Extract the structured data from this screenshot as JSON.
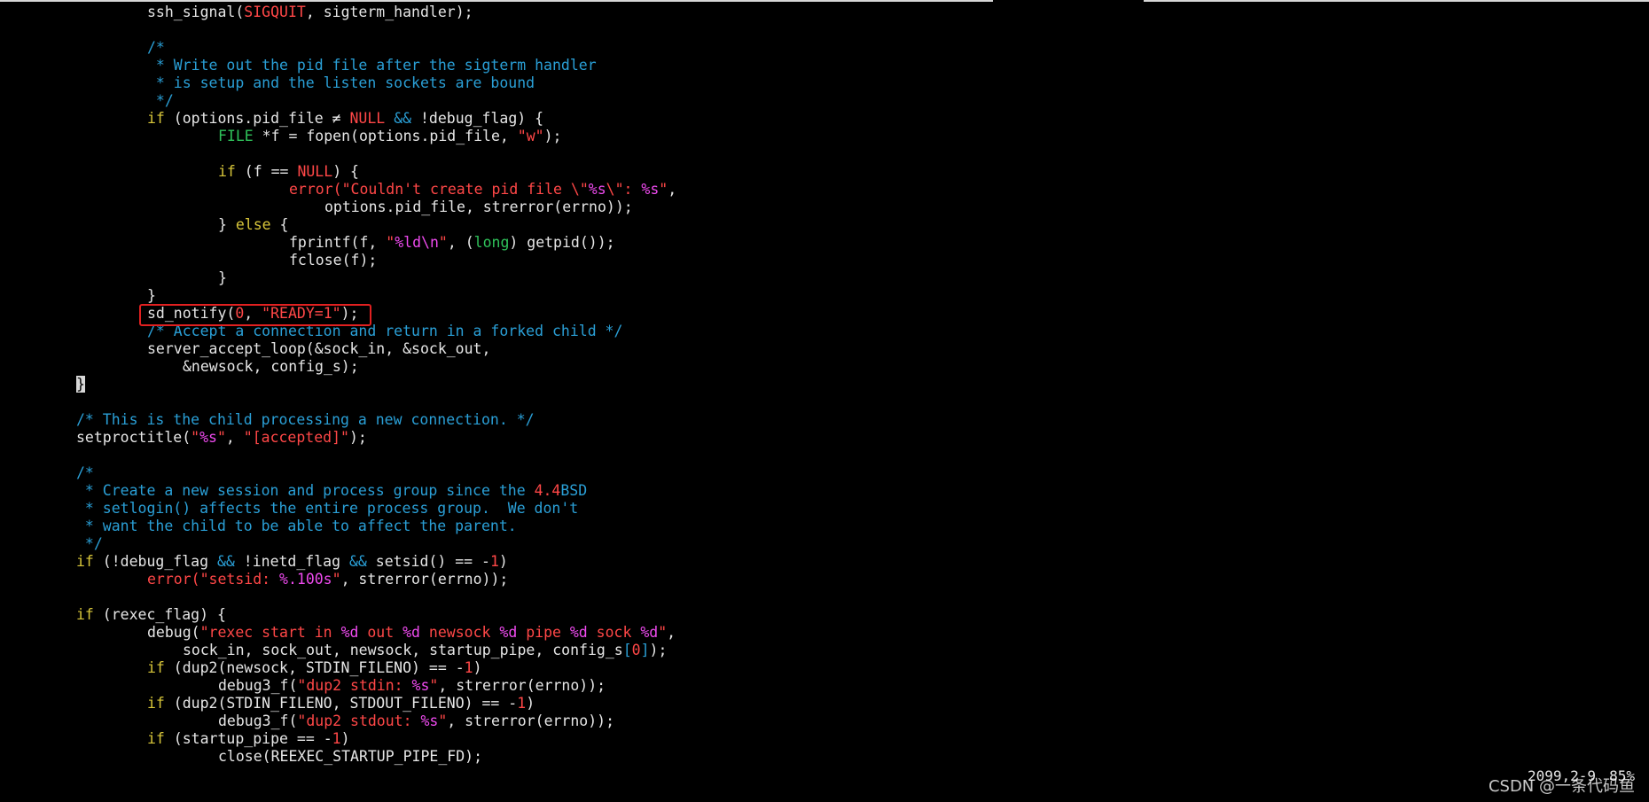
{
  "editor": {
    "lines": [
      {
        "indent": 2,
        "tokens": [
          [
            "fn-plain",
            "ssh_signal("
          ],
          [
            "const",
            "SIGQUIT"
          ],
          [
            "plain",
            ", sigterm_handler);"
          ]
        ]
      },
      {
        "indent": 0,
        "tokens": []
      },
      {
        "indent": 2,
        "tokens": [
          [
            "com",
            "/*"
          ]
        ]
      },
      {
        "indent": 2,
        "tokens": [
          [
            "com",
            " * Write out the pid file after the sigterm handler"
          ]
        ]
      },
      {
        "indent": 2,
        "tokens": [
          [
            "com",
            " * is setup and the listen sockets are bound"
          ]
        ]
      },
      {
        "indent": 2,
        "tokens": [
          [
            "com",
            " */"
          ]
        ]
      },
      {
        "indent": 2,
        "tokens": [
          [
            "kw",
            "if"
          ],
          [
            "plain",
            " (options.pid_file "
          ],
          [
            "plain",
            "≠"
          ],
          [
            "plain",
            " "
          ],
          [
            "const",
            "NULL"
          ],
          [
            "plain",
            " "
          ],
          [
            "op",
            "&&"
          ],
          [
            "plain",
            " !debug_flag) {"
          ]
        ]
      },
      {
        "indent": 4,
        "tokens": [
          [
            "type",
            "FILE"
          ],
          [
            "plain",
            " *f = fopen(options.pid_file, "
          ],
          [
            "str",
            "\"w\""
          ],
          [
            "plain",
            ");"
          ]
        ]
      },
      {
        "indent": 0,
        "tokens": []
      },
      {
        "indent": 4,
        "tokens": [
          [
            "kw",
            "if"
          ],
          [
            "plain",
            " (f "
          ],
          [
            "plain",
            "=="
          ],
          [
            "plain",
            " "
          ],
          [
            "const",
            "NULL"
          ],
          [
            "plain",
            ") {"
          ]
        ]
      },
      {
        "indent": 6,
        "tokens": [
          [
            "fn",
            "error("
          ],
          [
            "str",
            "\"Couldn't create pid file \\\""
          ],
          [
            "fmt",
            "%s"
          ],
          [
            "str",
            "\\\": "
          ],
          [
            "fmt",
            "%s"
          ],
          [
            "str",
            "\""
          ],
          [
            "plain",
            ","
          ]
        ]
      },
      {
        "indent": 7,
        "tokens": [
          [
            "plain",
            "options.pid_file, strerror(errno));"
          ]
        ]
      },
      {
        "indent": 4,
        "tokens": [
          [
            "plain",
            "} "
          ],
          [
            "kw",
            "else"
          ],
          [
            "plain",
            " {"
          ]
        ]
      },
      {
        "indent": 6,
        "tokens": [
          [
            "plain",
            "fprintf(f, "
          ],
          [
            "str",
            "\""
          ],
          [
            "fmt",
            "%ld\\n"
          ],
          [
            "str",
            "\""
          ],
          [
            "plain",
            ", ("
          ],
          [
            "type",
            "long"
          ],
          [
            "plain",
            ") getpid());"
          ]
        ]
      },
      {
        "indent": 6,
        "tokens": [
          [
            "plain",
            "fclose(f);"
          ]
        ]
      },
      {
        "indent": 4,
        "tokens": [
          [
            "plain",
            "}"
          ]
        ]
      },
      {
        "indent": 2,
        "tokens": [
          [
            "plain",
            "}"
          ]
        ]
      },
      {
        "indent": 2,
        "tokens": [
          [
            "plain",
            "sd_notify("
          ],
          [
            "num",
            "0"
          ],
          [
            "plain",
            ", "
          ],
          [
            "str",
            "\"READY=1\""
          ],
          [
            "plain",
            ");"
          ]
        ]
      },
      {
        "indent": 2,
        "tokens": [
          [
            "com",
            "/* Accept a connection and return in a forked child */"
          ]
        ]
      },
      {
        "indent": 2,
        "tokens": [
          [
            "plain",
            "server_accept_loop(&sock_in, &sock_out,"
          ]
        ]
      },
      {
        "indent": 3,
        "tokens": [
          [
            "plain",
            "&newsock, config_s);"
          ]
        ]
      },
      {
        "indent": 0,
        "tokens": [
          [
            "cursor",
            "}"
          ]
        ]
      },
      {
        "indent": 0,
        "tokens": []
      },
      {
        "indent": 0,
        "tokens": [
          [
            "com",
            "/* This is the child processing a new connection. */"
          ]
        ]
      },
      {
        "indent": 0,
        "tokens": [
          [
            "plain",
            "setproctitle("
          ],
          [
            "str",
            "\""
          ],
          [
            "fmt",
            "%s"
          ],
          [
            "str",
            "\""
          ],
          [
            "plain",
            ", "
          ],
          [
            "str",
            "\"[accepted]\""
          ],
          [
            "plain",
            ");"
          ]
        ]
      },
      {
        "indent": 0,
        "tokens": []
      },
      {
        "indent": 0,
        "tokens": [
          [
            "com",
            "/*"
          ]
        ]
      },
      {
        "indent": 0,
        "tokens": [
          [
            "com",
            " * Create a new session and process group since the "
          ],
          [
            "num",
            "4.4"
          ],
          [
            "com",
            "BSD"
          ]
        ]
      },
      {
        "indent": 0,
        "tokens": [
          [
            "com",
            " * setlogin() affects the entire process group.  We don't"
          ]
        ]
      },
      {
        "indent": 0,
        "tokens": [
          [
            "com",
            " * want the child to be able to affect the parent."
          ]
        ]
      },
      {
        "indent": 0,
        "tokens": [
          [
            "com",
            " */"
          ]
        ]
      },
      {
        "indent": 0,
        "tokens": [
          [
            "kw",
            "if"
          ],
          [
            "plain",
            " (!debug_flag "
          ],
          [
            "op",
            "&&"
          ],
          [
            "plain",
            " !inetd_flag "
          ],
          [
            "op",
            "&&"
          ],
          [
            "plain",
            " setsid() "
          ],
          [
            "plain",
            "=="
          ],
          [
            "plain",
            " -"
          ],
          [
            "num",
            "1"
          ],
          [
            "plain",
            ")"
          ]
        ]
      },
      {
        "indent": 2,
        "tokens": [
          [
            "fn",
            "error("
          ],
          [
            "str",
            "\"setsid: "
          ],
          [
            "fmt",
            "%.100s"
          ],
          [
            "str",
            "\""
          ],
          [
            "plain",
            ", strerror(errno));"
          ]
        ]
      },
      {
        "indent": 0,
        "tokens": []
      },
      {
        "indent": 0,
        "tokens": [
          [
            "kw",
            "if"
          ],
          [
            "plain",
            " (rexec_flag) {"
          ]
        ]
      },
      {
        "indent": 2,
        "tokens": [
          [
            "plain",
            "debug("
          ],
          [
            "str",
            "\"rexec start in "
          ],
          [
            "fmt",
            "%d"
          ],
          [
            "str",
            " out "
          ],
          [
            "fmt",
            "%d"
          ],
          [
            "str",
            " newsock "
          ],
          [
            "fmt",
            "%d"
          ],
          [
            "str",
            " pipe "
          ],
          [
            "fmt",
            "%d"
          ],
          [
            "str",
            " sock "
          ],
          [
            "fmt",
            "%d"
          ],
          [
            "str",
            "\""
          ],
          [
            "plain",
            ","
          ]
        ]
      },
      {
        "indent": 3,
        "tokens": [
          [
            "plain",
            "sock_in, sock_out, newsock, startup_pipe, config_s"
          ],
          [
            "op",
            "["
          ],
          [
            "num",
            "0"
          ],
          [
            "op",
            "]"
          ],
          [
            "plain",
            ");"
          ]
        ]
      },
      {
        "indent": 2,
        "tokens": [
          [
            "kw",
            "if"
          ],
          [
            "plain",
            " (dup2(newsock, STDIN_FILENO) "
          ],
          [
            "plain",
            "=="
          ],
          [
            "plain",
            " -"
          ],
          [
            "num",
            "1"
          ],
          [
            "plain",
            ")"
          ]
        ]
      },
      {
        "indent": 4,
        "tokens": [
          [
            "plain",
            "debug3_f("
          ],
          [
            "str",
            "\"dup2 stdin: "
          ],
          [
            "fmt",
            "%s"
          ],
          [
            "str",
            "\""
          ],
          [
            "plain",
            ", strerror(errno));"
          ]
        ]
      },
      {
        "indent": 2,
        "tokens": [
          [
            "kw",
            "if"
          ],
          [
            "plain",
            " (dup2(STDIN_FILENO, STDOUT_FILENO) "
          ],
          [
            "plain",
            "=="
          ],
          [
            "plain",
            " -"
          ],
          [
            "num",
            "1"
          ],
          [
            "plain",
            ")"
          ]
        ]
      },
      {
        "indent": 4,
        "tokens": [
          [
            "plain",
            "debug3_f("
          ],
          [
            "str",
            "\"dup2 stdout: "
          ],
          [
            "fmt",
            "%s"
          ],
          [
            "str",
            "\""
          ],
          [
            "plain",
            ", strerror(errno));"
          ]
        ]
      },
      {
        "indent": 2,
        "tokens": [
          [
            "kw",
            "if"
          ],
          [
            "plain",
            " (startup_pipe "
          ],
          [
            "plain",
            "=="
          ],
          [
            "plain",
            " -"
          ],
          [
            "num",
            "1"
          ],
          [
            "plain",
            ")"
          ]
        ]
      },
      {
        "indent": 4,
        "tokens": [
          [
            "plain",
            "close(REEXEC_STARTUP_PIPE_FD);"
          ]
        ]
      }
    ],
    "highlighted_line": 17
  },
  "status_bar": {
    "position": "2099,2-9",
    "percent": "85%"
  },
  "watermark": "CSDN @一条代码鱼",
  "colors": {
    "background": "#000000",
    "keyword": "#d8c63a",
    "type": "#2fc25a",
    "string": "#ff4747",
    "format": "#ee4aee",
    "comment": "#2a9fd6",
    "highlight_box": "#e02020"
  }
}
